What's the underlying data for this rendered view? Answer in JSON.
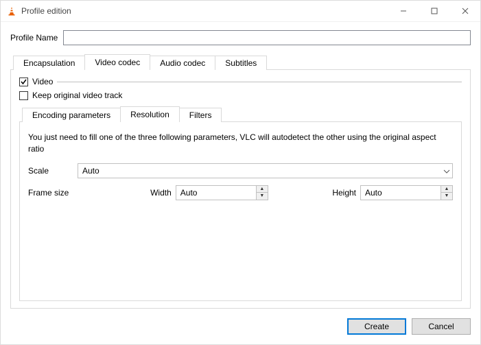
{
  "window": {
    "title": "Profile edition"
  },
  "profile": {
    "name_label": "Profile Name",
    "name_value": ""
  },
  "tabs": {
    "encapsulation": "Encapsulation",
    "video_codec": "Video codec",
    "audio_codec": "Audio codec",
    "subtitles": "Subtitles"
  },
  "video_codec": {
    "video_checkbox_label": "Video",
    "video_checkbox_checked": true,
    "keep_original_label": "Keep original video track",
    "keep_original_checked": false,
    "inner_tabs": {
      "encoding_params": "Encoding parameters",
      "resolution": "Resolution",
      "filters": "Filters"
    },
    "resolution": {
      "help": "You just need to fill one of the three following parameters, VLC will autodetect the other using the original aspect ratio",
      "scale_label": "Scale",
      "scale_value": "Auto",
      "frame_size_label": "Frame size",
      "width_label": "Width",
      "width_value": "Auto",
      "height_label": "Height",
      "height_value": "Auto"
    }
  },
  "buttons": {
    "create": "Create",
    "cancel": "Cancel"
  }
}
